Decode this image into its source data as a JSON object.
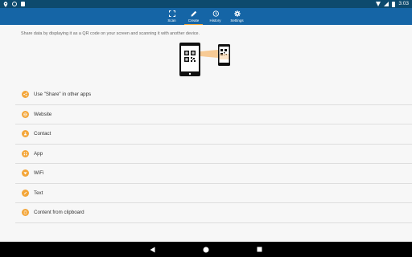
{
  "status_bar": {
    "time": "3:03",
    "icons": [
      "location-icon",
      "sync-icon",
      "sd-card-icon",
      "wifi-icon",
      "signal-icon",
      "battery-icon"
    ]
  },
  "tabs": [
    {
      "label": "Scan",
      "icon": "scan-icon"
    },
    {
      "label": "Create",
      "icon": "pencil-icon",
      "active": true
    },
    {
      "label": "History",
      "icon": "history-icon"
    },
    {
      "label": "Settings",
      "icon": "gear-icon"
    }
  ],
  "intro_text": "Share data by displaying it as a QR code on your screen and scanning it with another device.",
  "items": [
    {
      "label": "Use \"Share\" in other apps",
      "icon": "share-icon"
    },
    {
      "label": "Website",
      "icon": "globe-icon"
    },
    {
      "label": "Contact",
      "icon": "contact-icon"
    },
    {
      "label": "App",
      "icon": "app-icon"
    },
    {
      "label": "WiFi",
      "icon": "wifi-icon"
    },
    {
      "label": "Text",
      "icon": "text-icon"
    },
    {
      "label": "Content from clipboard",
      "icon": "clipboard-icon"
    }
  ],
  "colors": {
    "status_bar": "#0d4a6e",
    "toolbar": "#1565a6",
    "accent": "#f3a63a",
    "background": "#f7f7f7"
  }
}
